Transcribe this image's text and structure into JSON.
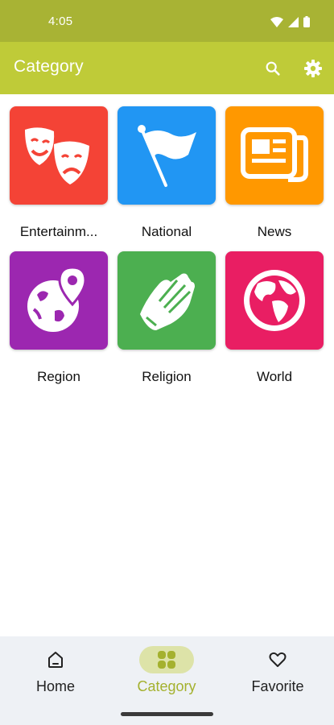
{
  "status_bar": {
    "time": "4:05"
  },
  "app_bar": {
    "title": "Category",
    "search_icon": "search-icon",
    "settings_icon": "gear-icon"
  },
  "categories": [
    {
      "label": "Entertainm...",
      "icon": "theater-masks-icon",
      "color": "#f44336"
    },
    {
      "label": "National",
      "icon": "flag-icon",
      "color": "#2196f3"
    },
    {
      "label": "News",
      "icon": "newspaper-icon",
      "color": "#ff9800"
    },
    {
      "label": "Region",
      "icon": "globe-pin-icon",
      "color": "#9c27b0"
    },
    {
      "label": "Religion",
      "icon": "praying-hands-icon",
      "color": "#4caf50"
    },
    {
      "label": "World",
      "icon": "globe-icon",
      "color": "#e91e63"
    }
  ],
  "bottom_nav": {
    "items": [
      {
        "label": "Home",
        "icon": "home-icon",
        "active": false
      },
      {
        "label": "Category",
        "icon": "category-grid-icon",
        "active": true
      },
      {
        "label": "Favorite",
        "icon": "heart-icon",
        "active": false
      }
    ]
  },
  "colors": {
    "status_bar": "#a8b334",
    "app_bar": "#bfcb38",
    "accent": "#a4b12e",
    "nav_bg": "#eef1f5"
  }
}
